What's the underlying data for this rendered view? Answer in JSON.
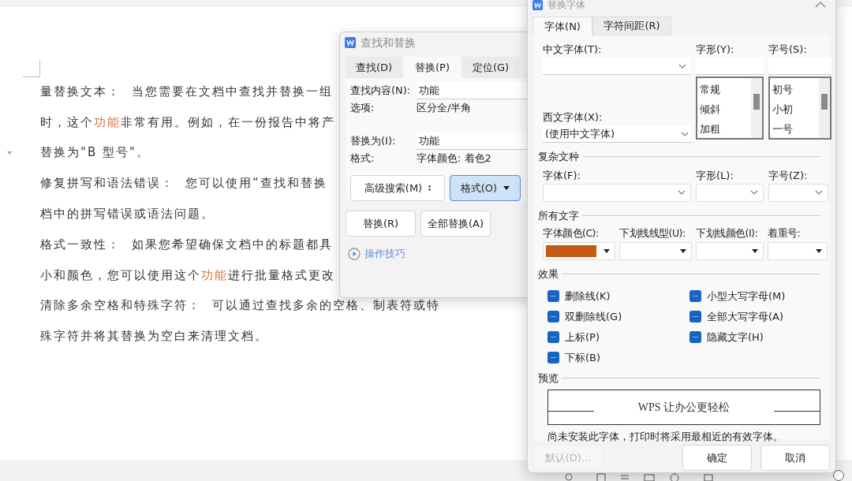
{
  "document": {
    "lines": [
      {
        "segments": [
          {
            "text": "量替换文本：",
            "highlight": false
          },
          {
            "text": "当您需要在文档中查找并替换一组",
            "highlight": false
          }
        ]
      },
      {
        "segments": [
          {
            "text": "时，这个",
            "highlight": false
          },
          {
            "text": "功能",
            "highlight": true
          },
          {
            "text": "非常有用。例如，在一份报告中将产",
            "highlight": false
          }
        ]
      },
      {
        "segments": [
          {
            "text": "替换为\"B 型号\"。",
            "highlight": false
          }
        ]
      },
      {
        "segments": [
          {
            "text": "修复拼写和语法错误：",
            "highlight": false
          },
          {
            "text": "您可以使用“查找和替换",
            "highlight": false
          }
        ]
      },
      {
        "segments": [
          {
            "text": "档中的拼写错误或语法问题。",
            "highlight": false
          }
        ]
      },
      {
        "segments": [
          {
            "text": "格式一致性：",
            "highlight": false
          },
          {
            "text": "如果您希望确保文档中的标题都具",
            "highlight": false
          }
        ]
      },
      {
        "segments": [
          {
            "text": "小和颜色，您可以使用这个",
            "highlight": false
          },
          {
            "text": "功能",
            "highlight": true
          },
          {
            "text": "进行批量格式更改",
            "highlight": false
          }
        ]
      },
      {
        "segments": [
          {
            "text": "清除多余空格和特殊字符：",
            "highlight": false
          },
          {
            "text": "可以通过查找多余的空格、制表符或特",
            "highlight": false
          }
        ]
      },
      {
        "segments": [
          {
            "text": "殊字符并将其替换为空白来清理文档。",
            "highlight": false
          }
        ]
      }
    ]
  },
  "find_dialog": {
    "title": "查找和替换",
    "tabs": [
      {
        "label": "查找(D)",
        "selected": false
      },
      {
        "label": "替换(P)",
        "selected": true
      },
      {
        "label": "定位(G)",
        "selected": false
      }
    ],
    "find_label": "查找内容(N):",
    "find_value": "功能",
    "options_label": "选项:",
    "options_value": "区分全/半角",
    "replace_label": "替换为(I):",
    "replace_value": "功能",
    "format_label": "格式:",
    "format_value": "字体颜色: 着色2",
    "buttons": [
      {
        "label": "高级搜索(M)",
        "kind": "more",
        "selected": false
      },
      {
        "label": "格式(O)",
        "kind": "dropdown",
        "selected": true
      }
    ],
    "action_buttons": [
      "替换(R)",
      "全部替换(A)"
    ],
    "tips_link": "操作技巧"
  },
  "font_dialog": {
    "title": "替换字体",
    "tabs": [
      {
        "label": "字体(N)",
        "selected": true
      },
      {
        "label": "字符间距(R)",
        "selected": false
      }
    ],
    "chinese_font": {
      "label": "中文字体(T):"
    },
    "style": {
      "label": "字形(Y):",
      "options": [
        "常规",
        "倾斜",
        "加粗"
      ]
    },
    "size": {
      "label": "字号(S):",
      "options": [
        "初号",
        "小初",
        "一号"
      ]
    },
    "western_font": {
      "label": "西文字体(X):",
      "value": "(使用中文字体)"
    },
    "complex": {
      "heading": "复杂文种",
      "fields": [
        {
          "label": "字体(F):"
        },
        {
          "label": "字形(L):"
        },
        {
          "label": "字号(Z):"
        }
      ]
    },
    "all_text": {
      "heading": "所有文字",
      "fields": [
        {
          "label": "字体颜色(C):",
          "color": "#c55a11"
        },
        {
          "label": "下划线线型(U):"
        },
        {
          "label": "下划线颜色(I):"
        },
        {
          "label": "着重号:"
        }
      ]
    },
    "effects": {
      "heading": "效果",
      "items": [
        {
          "label": "删除线(K)",
          "indeterminate": true
        },
        {
          "label": "小型大写字母(M)",
          "indeterminate": true
        },
        {
          "label": "双删除线(G)",
          "indeterminate": true
        },
        {
          "label": "全部大写字母(A)",
          "indeterminate": true
        },
        {
          "label": "上标(P)",
          "indeterminate": true
        },
        {
          "label": "隐藏文字(H)",
          "indeterminate": true
        },
        {
          "label": "下标(B)",
          "indeterminate": true
        }
      ]
    },
    "preview": {
      "heading": "预览",
      "sample": "WPS 让办公更轻松"
    },
    "note": "尚未安装此字体，打印时将采用最相近的有效字体。",
    "buttons": [
      {
        "label": "默认(D)...",
        "disabled": true
      },
      {
        "label": "确定",
        "disabled": false
      },
      {
        "label": "取消",
        "disabled": false
      }
    ]
  }
}
